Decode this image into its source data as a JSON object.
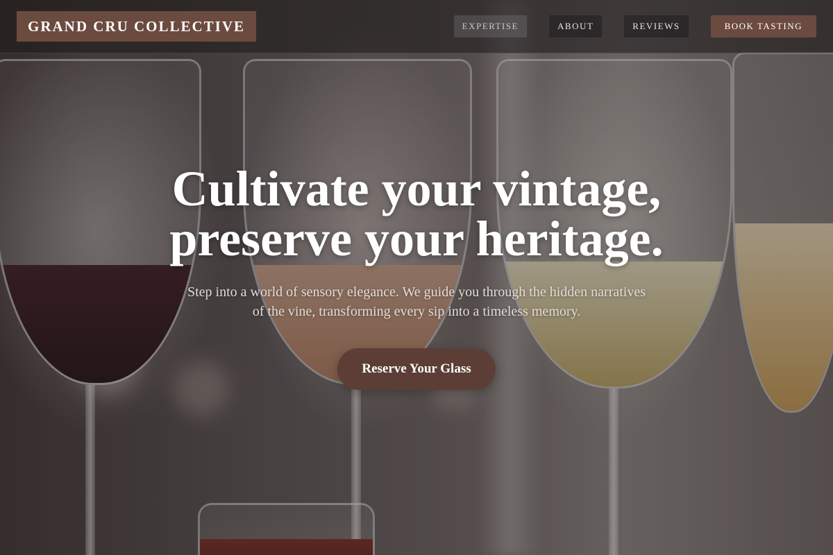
{
  "brand": {
    "name": "GRAND CRU COLLECTIVE"
  },
  "nav": {
    "items": [
      {
        "label": "EXPERTISE"
      },
      {
        "label": "ABOUT"
      },
      {
        "label": "REVIEWS"
      }
    ],
    "cta_label": "BOOK TASTING"
  },
  "hero": {
    "headline_line1": "Cultivate your vintage,",
    "headline_line2": "preserve your heritage.",
    "subtitle_line1": "Step into a world of sensory elegance. We guide you through the hidden narratives",
    "subtitle_line2": "of the vine, transforming every sip into a timeless memory.",
    "button_label": "Reserve Your Glass"
  },
  "colors": {
    "brand_accent": "#6b4a40",
    "button_bg": "#5c3e36",
    "text_light": "#ffffff"
  },
  "background": {
    "image_subject": "wine-glasses-photo"
  }
}
